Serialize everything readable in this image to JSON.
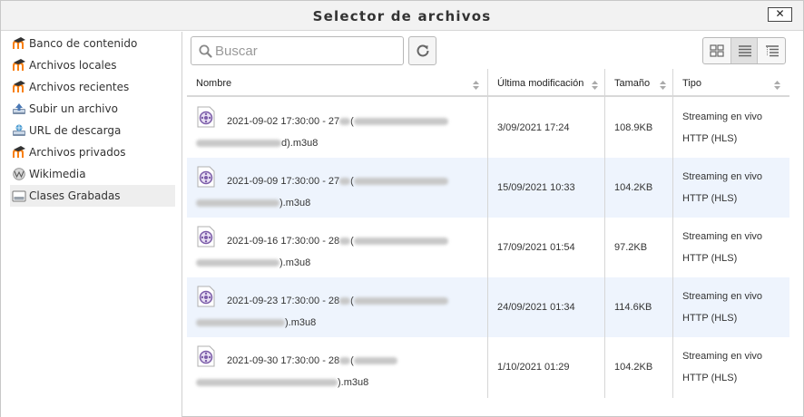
{
  "dialog": {
    "title": "Selector de archivos",
    "close_label": "✕"
  },
  "sidebar": {
    "items": [
      {
        "label": "Banco de contenido",
        "icon": "moodle-icon"
      },
      {
        "label": "Archivos locales",
        "icon": "moodle-icon"
      },
      {
        "label": "Archivos recientes",
        "icon": "moodle-icon"
      },
      {
        "label": "Subir un archivo",
        "icon": "upload-icon"
      },
      {
        "label": "URL de descarga",
        "icon": "url-download-icon"
      },
      {
        "label": "Archivos privados",
        "icon": "moodle-icon"
      },
      {
        "label": "Wikimedia",
        "icon": "wikimedia-icon"
      },
      {
        "label": "Clases Grabadas",
        "icon": "recordings-icon",
        "active": true
      }
    ]
  },
  "toolbar": {
    "search_placeholder": "Buscar",
    "view_selected": "list"
  },
  "table": {
    "columns": [
      "Nombre",
      "Última modificación",
      "Tamaño",
      "Tipo"
    ],
    "rows": [
      {
        "name_line1": "2021-09-02 17:30:00 - 27",
        "name_line2": "d).m3u8",
        "modified": "3/09/2021 17:24",
        "size": "108.9KB",
        "type_line1": "Streaming en vivo",
        "type_line2": "HTTP (HLS)"
      },
      {
        "name_line1": "2021-09-09 17:30:00 - 27",
        "name_line2": ").m3u8",
        "modified": "15/09/2021 10:33",
        "size": "104.2KB",
        "type_line1": "Streaming en vivo",
        "type_line2": "HTTP (HLS)"
      },
      {
        "name_line1": "2021-09-16 17:30:00 - 28",
        "name_line2": ").m3u8",
        "modified": "17/09/2021 01:54",
        "size": "97.2KB",
        "type_line1": "Streaming en vivo",
        "type_line2": "HTTP (HLS)"
      },
      {
        "name_line1": "2021-09-23 17:30:00 - 28",
        "name_line2": ").m3u8",
        "modified": "24/09/2021 01:34",
        "size": "114.6KB",
        "type_line1": "Streaming en vivo",
        "type_line2": "HTTP (HLS)"
      },
      {
        "name_line1": "2021-09-30 17:30:00 - 28",
        "name_line2": ").m3u8",
        "modified": "1/10/2021 01:29",
        "size": "104.2KB",
        "type_line1": "Streaming en vivo",
        "type_line2": "HTTP (HLS)"
      }
    ]
  }
}
